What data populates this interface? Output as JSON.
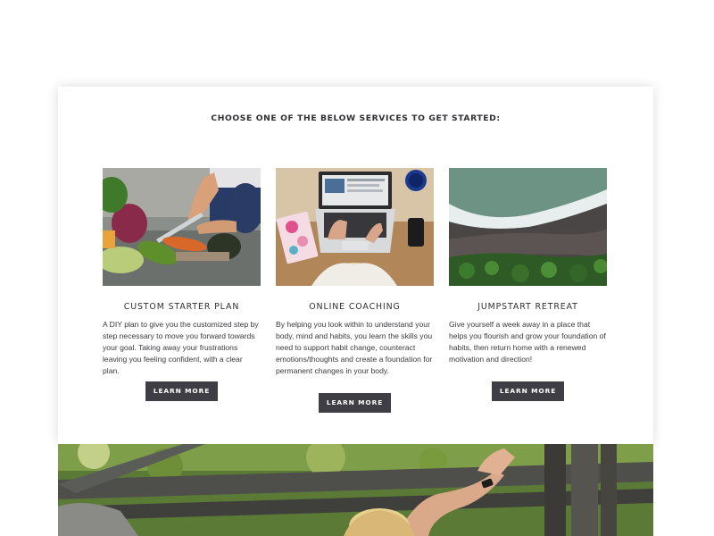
{
  "services_heading": "CHOOSE ONE OF THE BELOW SERVICES TO GET STARTED:",
  "services": [
    {
      "title": "CUSTOM STARTER PLAN",
      "description": "A DIY plan to give you the customized step by step necessary to move you forward towards your goal. Taking away your frustrations leaving you feeling confident, with a clear plan.",
      "button_label": "LEARN MORE"
    },
    {
      "title": "ONLINE COACHING",
      "description": "By helping you look within to understand your body, mind and habits, you learn the skills you need to support habit change, counteract emotions/thoughts and create a foundation for permanent changes in your body.",
      "button_label": "LEARN MORE"
    },
    {
      "title": "JUMPSTART RETREAT",
      "description": "Give yourself a week away in a place that helps you flourish and grow your foundation of habits, then return home with a renewed motivation and direction!",
      "button_label": "LEARN MORE"
    }
  ],
  "colors": {
    "button_bg": "#3e3e44",
    "heading_text": "#2f2f33",
    "body_text": "#3a3a3e"
  }
}
